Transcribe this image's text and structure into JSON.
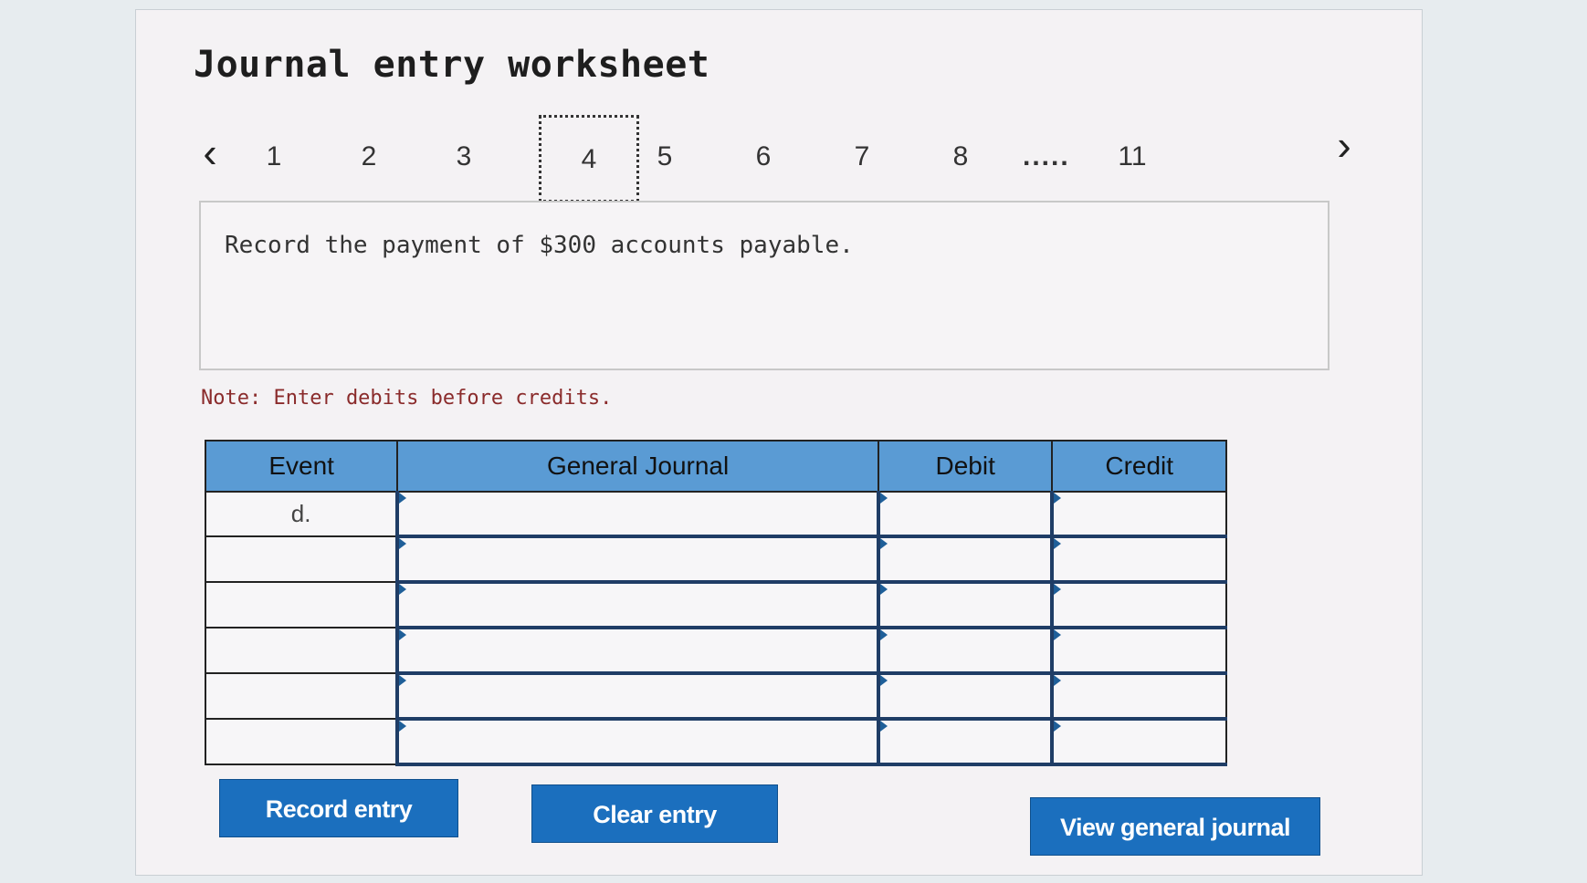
{
  "title": "Journal entry worksheet",
  "pager": {
    "prev_icon": "chevron-left-icon",
    "next_icon": "chevron-right-icon",
    "pages": [
      "1",
      "2",
      "3",
      "4",
      "5",
      "6",
      "7",
      "8"
    ],
    "active_page": "4",
    "ellipsis": ".....",
    "last_page": "11"
  },
  "question": {
    "text": "Record the payment of $300 accounts payable."
  },
  "note": "Note: Enter debits before credits.",
  "table": {
    "columns": [
      "Event",
      "General Journal",
      "Debit",
      "Credit"
    ],
    "rows": [
      {
        "event": "d.",
        "general_journal": "",
        "debit": "",
        "credit": ""
      },
      {
        "event": "",
        "general_journal": "",
        "debit": "",
        "credit": ""
      },
      {
        "event": "",
        "general_journal": "",
        "debit": "",
        "credit": ""
      },
      {
        "event": "",
        "general_journal": "",
        "debit": "",
        "credit": ""
      },
      {
        "event": "",
        "general_journal": "",
        "debit": "",
        "credit": ""
      },
      {
        "event": "",
        "general_journal": "",
        "debit": "",
        "credit": ""
      }
    ]
  },
  "buttons": {
    "record": "Record entry",
    "clear": "Clear entry",
    "view": "View general journal"
  },
  "colors": {
    "header_bg": "#5a9bd4",
    "button_bg": "#1b6fbe",
    "note_text": "#8a2b2b"
  }
}
